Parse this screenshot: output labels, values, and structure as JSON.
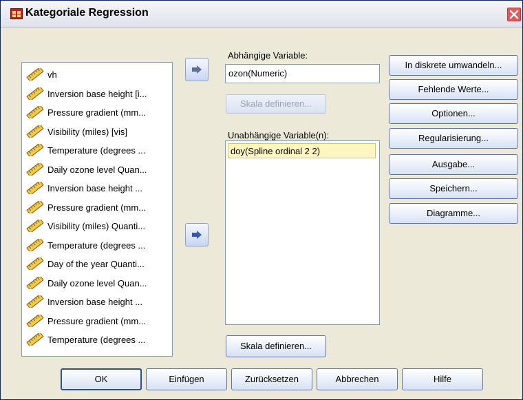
{
  "window": {
    "title": "Kategoriale Regression",
    "icon": "grid-table-icon",
    "close_icon": "close-x-icon"
  },
  "variables": [
    {
      "label": "vh",
      "icon": "ruler-icon"
    },
    {
      "label": "Inversion base height [i...",
      "icon": "ruler-icon"
    },
    {
      "label": "Pressure gradient (mm...",
      "icon": "ruler-icon"
    },
    {
      "label": "Visibility (miles) [vis]",
      "icon": "ruler-icon"
    },
    {
      "label": "Temperature (degrees ...",
      "icon": "ruler-icon"
    },
    {
      "label": "Daily ozone level Quan...",
      "icon": "ruler-icon"
    },
    {
      "label": "Inversion base height ...",
      "icon": "ruler-icon"
    },
    {
      "label": "Pressure gradient (mm...",
      "icon": "ruler-icon"
    },
    {
      "label": "Visibility (miles) Quanti...",
      "icon": "ruler-icon"
    },
    {
      "label": "Temperature (degrees ...",
      "icon": "ruler-icon"
    },
    {
      "label": "Day of the year Quanti...",
      "icon": "ruler-icon"
    },
    {
      "label": "Daily ozone level Quan...",
      "icon": "ruler-icon"
    },
    {
      "label": "Inversion base height ...",
      "icon": "ruler-icon"
    },
    {
      "label": "Pressure gradient (mm...",
      "icon": "ruler-icon"
    },
    {
      "label": "Temperature (degrees ...",
      "icon": "ruler-icon"
    }
  ],
  "dependent": {
    "label": "Abhängige Variable:",
    "value": "ozon(Numeric)",
    "scale_button": "Skala definieren..."
  },
  "independent": {
    "label": "Unabhängige Variable(n):",
    "items": [
      "doy(Spline ordinal 2 2)"
    ],
    "scale_button": "Skala definieren..."
  },
  "side_buttons": [
    "In diskrete umwandeln...",
    "Fehlende Werte...",
    "Optionen...",
    "Regularisierung...",
    "Ausgabe...",
    "Speichern...",
    "Diagramme..."
  ],
  "bottom_buttons": [
    "OK",
    "Einfügen",
    "Zurücksetzen",
    "Abbrechen",
    "Hilfe"
  ],
  "colors": {
    "selected_item": "#fef6c0",
    "title_accent": "#c81c1c"
  }
}
